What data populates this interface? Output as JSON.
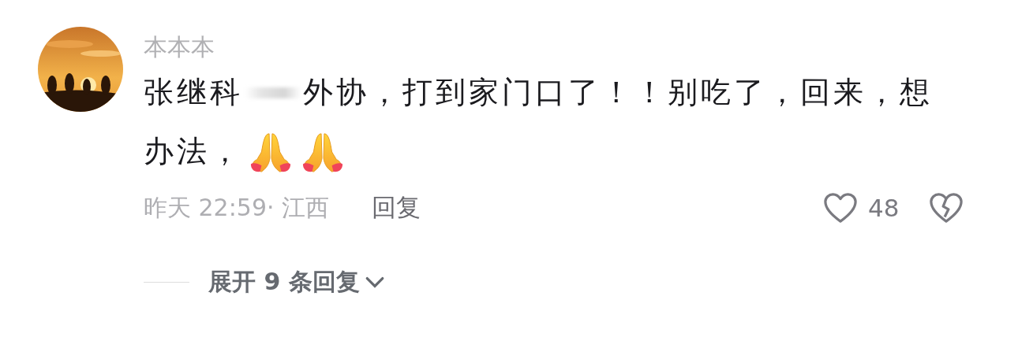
{
  "comment": {
    "author": "本本本",
    "body": {
      "before_redaction": "张继科",
      "redacted": true,
      "after_redaction": "外协，打到家门口了！！别吃了，回来，想",
      "second_line": "办法，",
      "emojis": [
        {
          "kind": "prayer_hands"
        },
        {
          "kind": "prayer_hands"
        }
      ]
    },
    "time": "昨天 22:59· 江西",
    "reply_button": "回复",
    "like_count": "48",
    "liked": false,
    "expand_replies": "展开 9 条回复"
  }
}
